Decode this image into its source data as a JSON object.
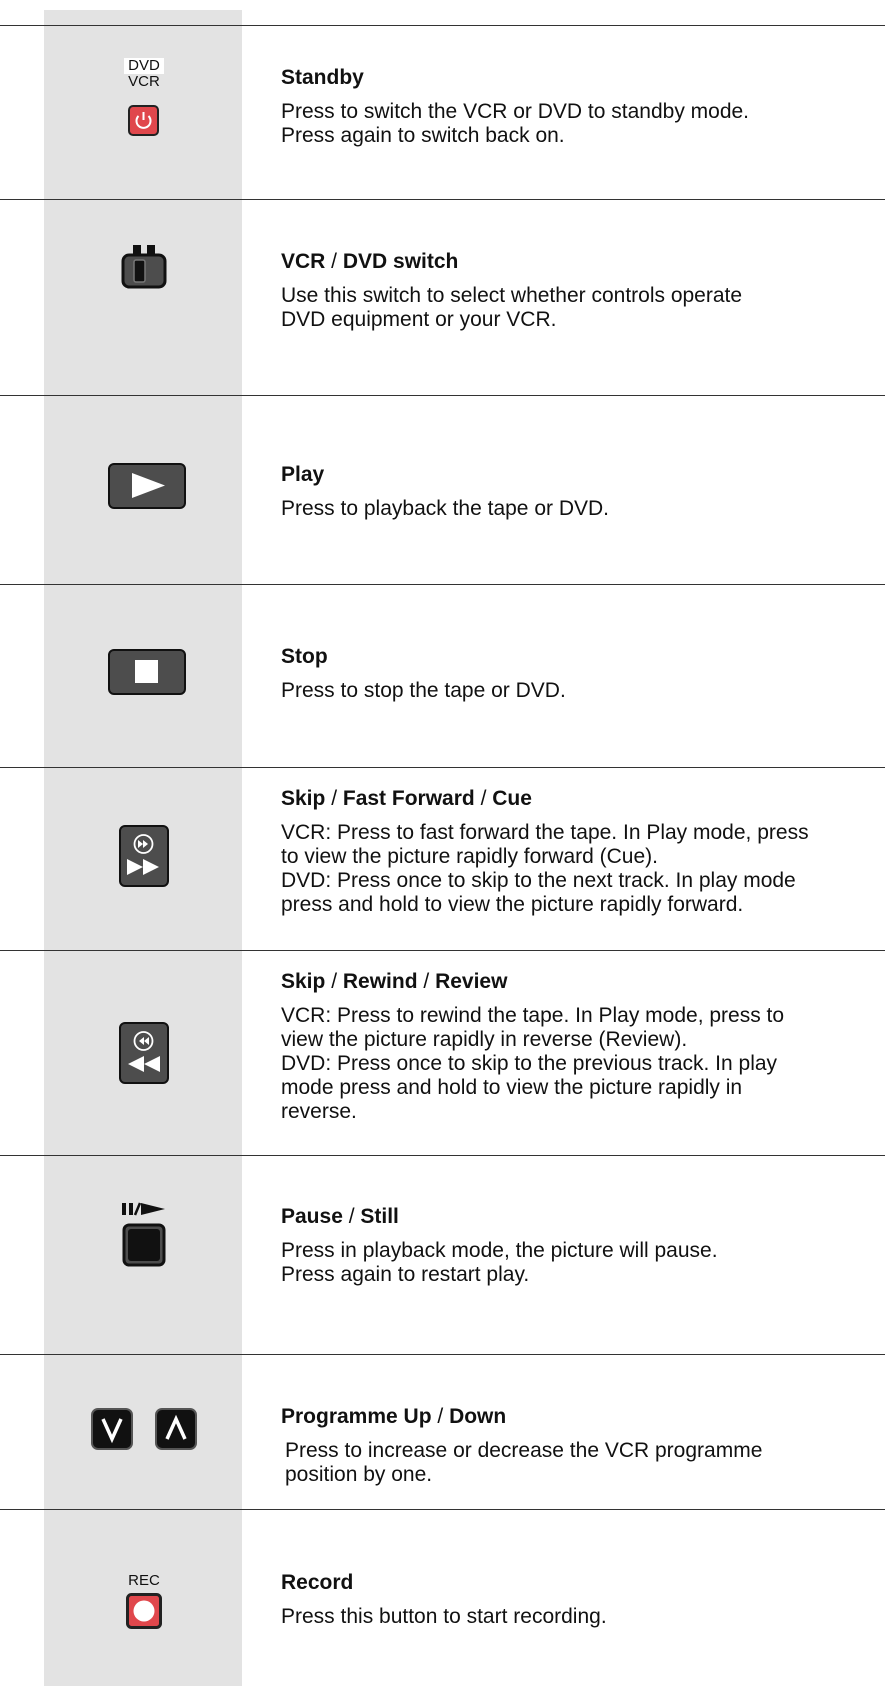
{
  "entries": [
    {
      "title": [
        "Standby"
      ],
      "desc": [
        "Press to switch the VCR or DVD to standby mode.",
        "Press again to switch back on."
      ],
      "icon": "standby-power-icon",
      "labels": [
        "DVD",
        "VCR"
      ],
      "icon_color": "#e0474c"
    },
    {
      "title": [
        "VCR",
        "DVD switch"
      ],
      "desc": [
        "Use this switch to select whether controls operate",
        "DVD equipment or your VCR."
      ],
      "icon": "vcr-dvd-switch-icon"
    },
    {
      "title": [
        "Play"
      ],
      "desc": [
        "Press to playback the tape or DVD."
      ],
      "icon": "play-icon"
    },
    {
      "title": [
        "Stop"
      ],
      "desc": [
        "Press to stop the tape or DVD."
      ],
      "icon": "stop-icon"
    },
    {
      "title": [
        "Skip",
        "Fast Forward",
        "Cue"
      ],
      "desc": [
        "VCR: Press to fast forward the tape. In Play mode, press",
        "to view the picture rapidly forward (Cue).",
        "DVD: Press once to skip to the next track.  In play mode",
        "press and hold to view the picture rapidly forward."
      ],
      "icon": "fast-forward-skip-icon"
    },
    {
      "title": [
        "Skip",
        "Rewind",
        "Review"
      ],
      "desc": [
        "VCR: Press to rewind the tape. In Play mode, press to",
        "view the picture rapidly in reverse (Review).",
        "DVD: Press once to skip to the previous track.  In play",
        "mode press and hold to view the picture rapidly in",
        "reverse."
      ],
      "icon": "rewind-skip-icon"
    },
    {
      "title": [
        "Pause",
        "Still"
      ],
      "desc": [
        "Press in playback mode, the picture will pause.",
        "Press again to restart play."
      ],
      "icon": "pause-play-icon"
    },
    {
      "title": [
        "Programme Up",
        "Down"
      ],
      "desc": [
        "Press to increase or decrease the VCR programme",
        "position by one."
      ],
      "icon": "programme-up-down-icon"
    },
    {
      "title": [
        "Record"
      ],
      "desc": [
        "Press this button to start recording."
      ],
      "icon": "record-icon",
      "labels": [
        "REC"
      ],
      "icon_color": "#e0474c"
    }
  ],
  "colors": {
    "column_gray": "#e3e3e3",
    "button_dark": "#4d4d4d",
    "accent_red": "#e0474c"
  }
}
